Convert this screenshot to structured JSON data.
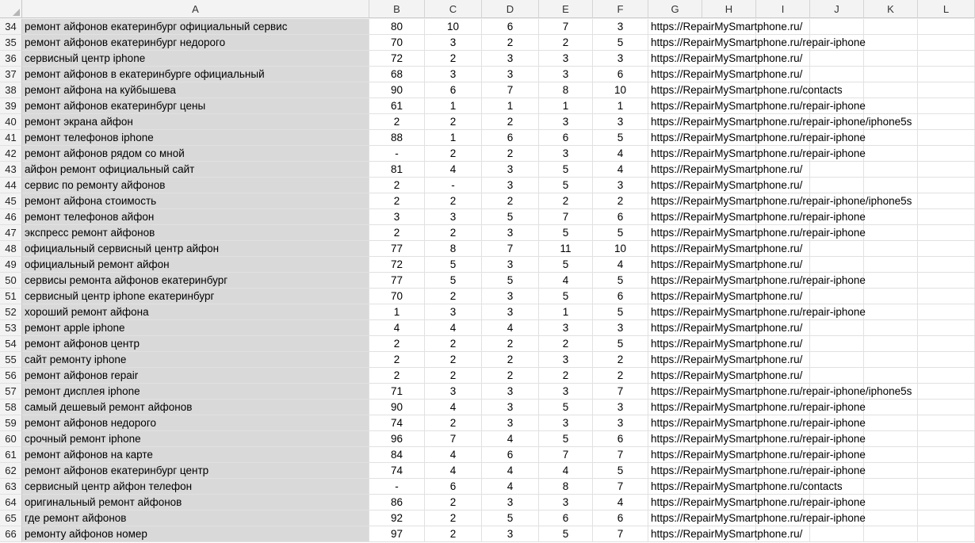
{
  "columns": [
    "A",
    "B",
    "C",
    "D",
    "E",
    "F",
    "G",
    "H",
    "I",
    "J",
    "K",
    "L"
  ],
  "rows": [
    {
      "n": "34",
      "a": "ремонт айфонов екатеринбург официальный сервис",
      "b": "80",
      "c": "10",
      "d": "6",
      "e": "7",
      "f": "3",
      "g": "https://RepairMySmartphone.ru/"
    },
    {
      "n": "35",
      "a": "ремонт айфонов екатеринбург недорого",
      "b": "70",
      "c": "3",
      "d": "2",
      "e": "2",
      "f": "5",
      "g": "https://RepairMySmartphone.ru/repair-iphone"
    },
    {
      "n": "36",
      "a": "сервисный центр iphone",
      "b": "72",
      "c": "2",
      "d": "3",
      "e": "3",
      "f": "3",
      "g": "https://RepairMySmartphone.ru/"
    },
    {
      "n": "37",
      "a": "ремонт айфонов в екатеринбурге официальный",
      "b": "68",
      "c": "3",
      "d": "3",
      "e": "3",
      "f": "6",
      "g": "https://RepairMySmartphone.ru/"
    },
    {
      "n": "38",
      "a": "ремонт айфона на куйбышева",
      "b": "90",
      "c": "6",
      "d": "7",
      "e": "8",
      "f": "10",
      "g": "https://RepairMySmartphone.ru/contacts"
    },
    {
      "n": "39",
      "a": "ремонт айфонов екатеринбург цены",
      "b": "61",
      "c": "1",
      "d": "1",
      "e": "1",
      "f": "1",
      "g": "https://RepairMySmartphone.ru/repair-iphone"
    },
    {
      "n": "40",
      "a": "ремонт экрана айфон",
      "b": "2",
      "c": "2",
      "d": "2",
      "e": "3",
      "f": "3",
      "g": "https://RepairMySmartphone.ru/repair-iphone/iphone5s"
    },
    {
      "n": "41",
      "a": "ремонт телефонов iphone",
      "b": "88",
      "c": "1",
      "d": "6",
      "e": "6",
      "f": "5",
      "g": "https://RepairMySmartphone.ru/repair-iphone"
    },
    {
      "n": "42",
      "a": "ремонт айфонов рядом со мной",
      "b": "-",
      "c": "2",
      "d": "2",
      "e": "3",
      "f": "4",
      "g": "https://RepairMySmartphone.ru/repair-iphone"
    },
    {
      "n": "43",
      "a": "айфон ремонт официальный сайт",
      "b": "81",
      "c": "4",
      "d": "3",
      "e": "5",
      "f": "4",
      "g": "https://RepairMySmartphone.ru/"
    },
    {
      "n": "44",
      "a": "сервис по ремонту айфонов",
      "b": "2",
      "c": "-",
      "d": "3",
      "e": "5",
      "f": "3",
      "g": "https://RepairMySmartphone.ru/"
    },
    {
      "n": "45",
      "a": "ремонт айфона стоимость",
      "b": "2",
      "c": "2",
      "d": "2",
      "e": "2",
      "f": "2",
      "g": "https://RepairMySmartphone.ru/repair-iphone/iphone5s"
    },
    {
      "n": "46",
      "a": "ремонт телефонов айфон",
      "b": "3",
      "c": "3",
      "d": "5",
      "e": "7",
      "f": "6",
      "g": "https://RepairMySmartphone.ru/repair-iphone"
    },
    {
      "n": "47",
      "a": "экспресс ремонт айфонов",
      "b": "2",
      "c": "2",
      "d": "3",
      "e": "5",
      "f": "5",
      "g": "https://RepairMySmartphone.ru/repair-iphone"
    },
    {
      "n": "48",
      "a": "официальный сервисный центр айфон",
      "b": "77",
      "c": "8",
      "d": "7",
      "e": "11",
      "f": "10",
      "g": "https://RepairMySmartphone.ru/"
    },
    {
      "n": "49",
      "a": "официальный ремонт айфон",
      "b": "72",
      "c": "5",
      "d": "3",
      "e": "5",
      "f": "4",
      "g": "https://RepairMySmartphone.ru/"
    },
    {
      "n": "50",
      "a": "сервисы ремонта айфонов екатеринбург",
      "b": "77",
      "c": "5",
      "d": "5",
      "e": "4",
      "f": "5",
      "g": "https://RepairMySmartphone.ru/repair-iphone"
    },
    {
      "n": "51",
      "a": "сервисный центр iphone екатеринбург",
      "b": "70",
      "c": "2",
      "d": "3",
      "e": "5",
      "f": "6",
      "g": "https://RepairMySmartphone.ru/"
    },
    {
      "n": "52",
      "a": "хороший ремонт айфона",
      "b": "1",
      "c": "3",
      "d": "3",
      "e": "1",
      "f": "5",
      "g": "https://RepairMySmartphone.ru/repair-iphone"
    },
    {
      "n": "53",
      "a": "ремонт apple iphone",
      "b": "4",
      "c": "4",
      "d": "4",
      "e": "3",
      "f": "3",
      "g": "https://RepairMySmartphone.ru/"
    },
    {
      "n": "54",
      "a": "ремонт айфонов центр",
      "b": "2",
      "c": "2",
      "d": "2",
      "e": "2",
      "f": "5",
      "g": "https://RepairMySmartphone.ru/"
    },
    {
      "n": "55",
      "a": "сайт ремонту iphone",
      "b": "2",
      "c": "2",
      "d": "2",
      "e": "3",
      "f": "2",
      "g": "https://RepairMySmartphone.ru/"
    },
    {
      "n": "56",
      "a": "ремонт айфонов repair",
      "b": "2",
      "c": "2",
      "d": "2",
      "e": "2",
      "f": "2",
      "g": "https://RepairMySmartphone.ru/"
    },
    {
      "n": "57",
      "a": "ремонт дисплея iphone",
      "b": "71",
      "c": "3",
      "d": "3",
      "e": "3",
      "f": "7",
      "g": "https://RepairMySmartphone.ru/repair-iphone/iphone5s"
    },
    {
      "n": "58",
      "a": "самый дешевый ремонт айфонов",
      "b": "90",
      "c": "4",
      "d": "3",
      "e": "5",
      "f": "3",
      "g": "https://RepairMySmartphone.ru/repair-iphone"
    },
    {
      "n": "59",
      "a": "ремонт айфонов недорого",
      "b": "74",
      "c": "2",
      "d": "3",
      "e": "3",
      "f": "3",
      "g": "https://RepairMySmartphone.ru/repair-iphone"
    },
    {
      "n": "60",
      "a": "срочный ремонт iphone",
      "b": "96",
      "c": "7",
      "d": "4",
      "e": "5",
      "f": "6",
      "g": "https://RepairMySmartphone.ru/repair-iphone"
    },
    {
      "n": "61",
      "a": "ремонт айфонов на карте",
      "b": "84",
      "c": "4",
      "d": "6",
      "e": "7",
      "f": "7",
      "g": "https://RepairMySmartphone.ru/repair-iphone"
    },
    {
      "n": "62",
      "a": "ремонт айфонов екатеринбург центр",
      "b": "74",
      "c": "4",
      "d": "4",
      "e": "4",
      "f": "5",
      "g": "https://RepairMySmartphone.ru/repair-iphone"
    },
    {
      "n": "63",
      "a": "сервисный центр айфон телефон",
      "b": "-",
      "c": "6",
      "d": "4",
      "e": "8",
      "f": "7",
      "g": "https://RepairMySmartphone.ru/contacts"
    },
    {
      "n": "64",
      "a": "оригинальный ремонт айфонов",
      "b": "86",
      "c": "2",
      "d": "3",
      "e": "3",
      "f": "4",
      "g": "https://RepairMySmartphone.ru/repair-iphone"
    },
    {
      "n": "65",
      "a": "где ремонт айфонов",
      "b": "92",
      "c": "2",
      "d": "5",
      "e": "6",
      "f": "6",
      "g": "https://RepairMySmartphone.ru/repair-iphone"
    },
    {
      "n": "66",
      "a": "ремонту айфонов номер",
      "b": "97",
      "c": "2",
      "d": "3",
      "e": "5",
      "f": "7",
      "g": "https://RepairMySmartphone.ru/"
    }
  ]
}
